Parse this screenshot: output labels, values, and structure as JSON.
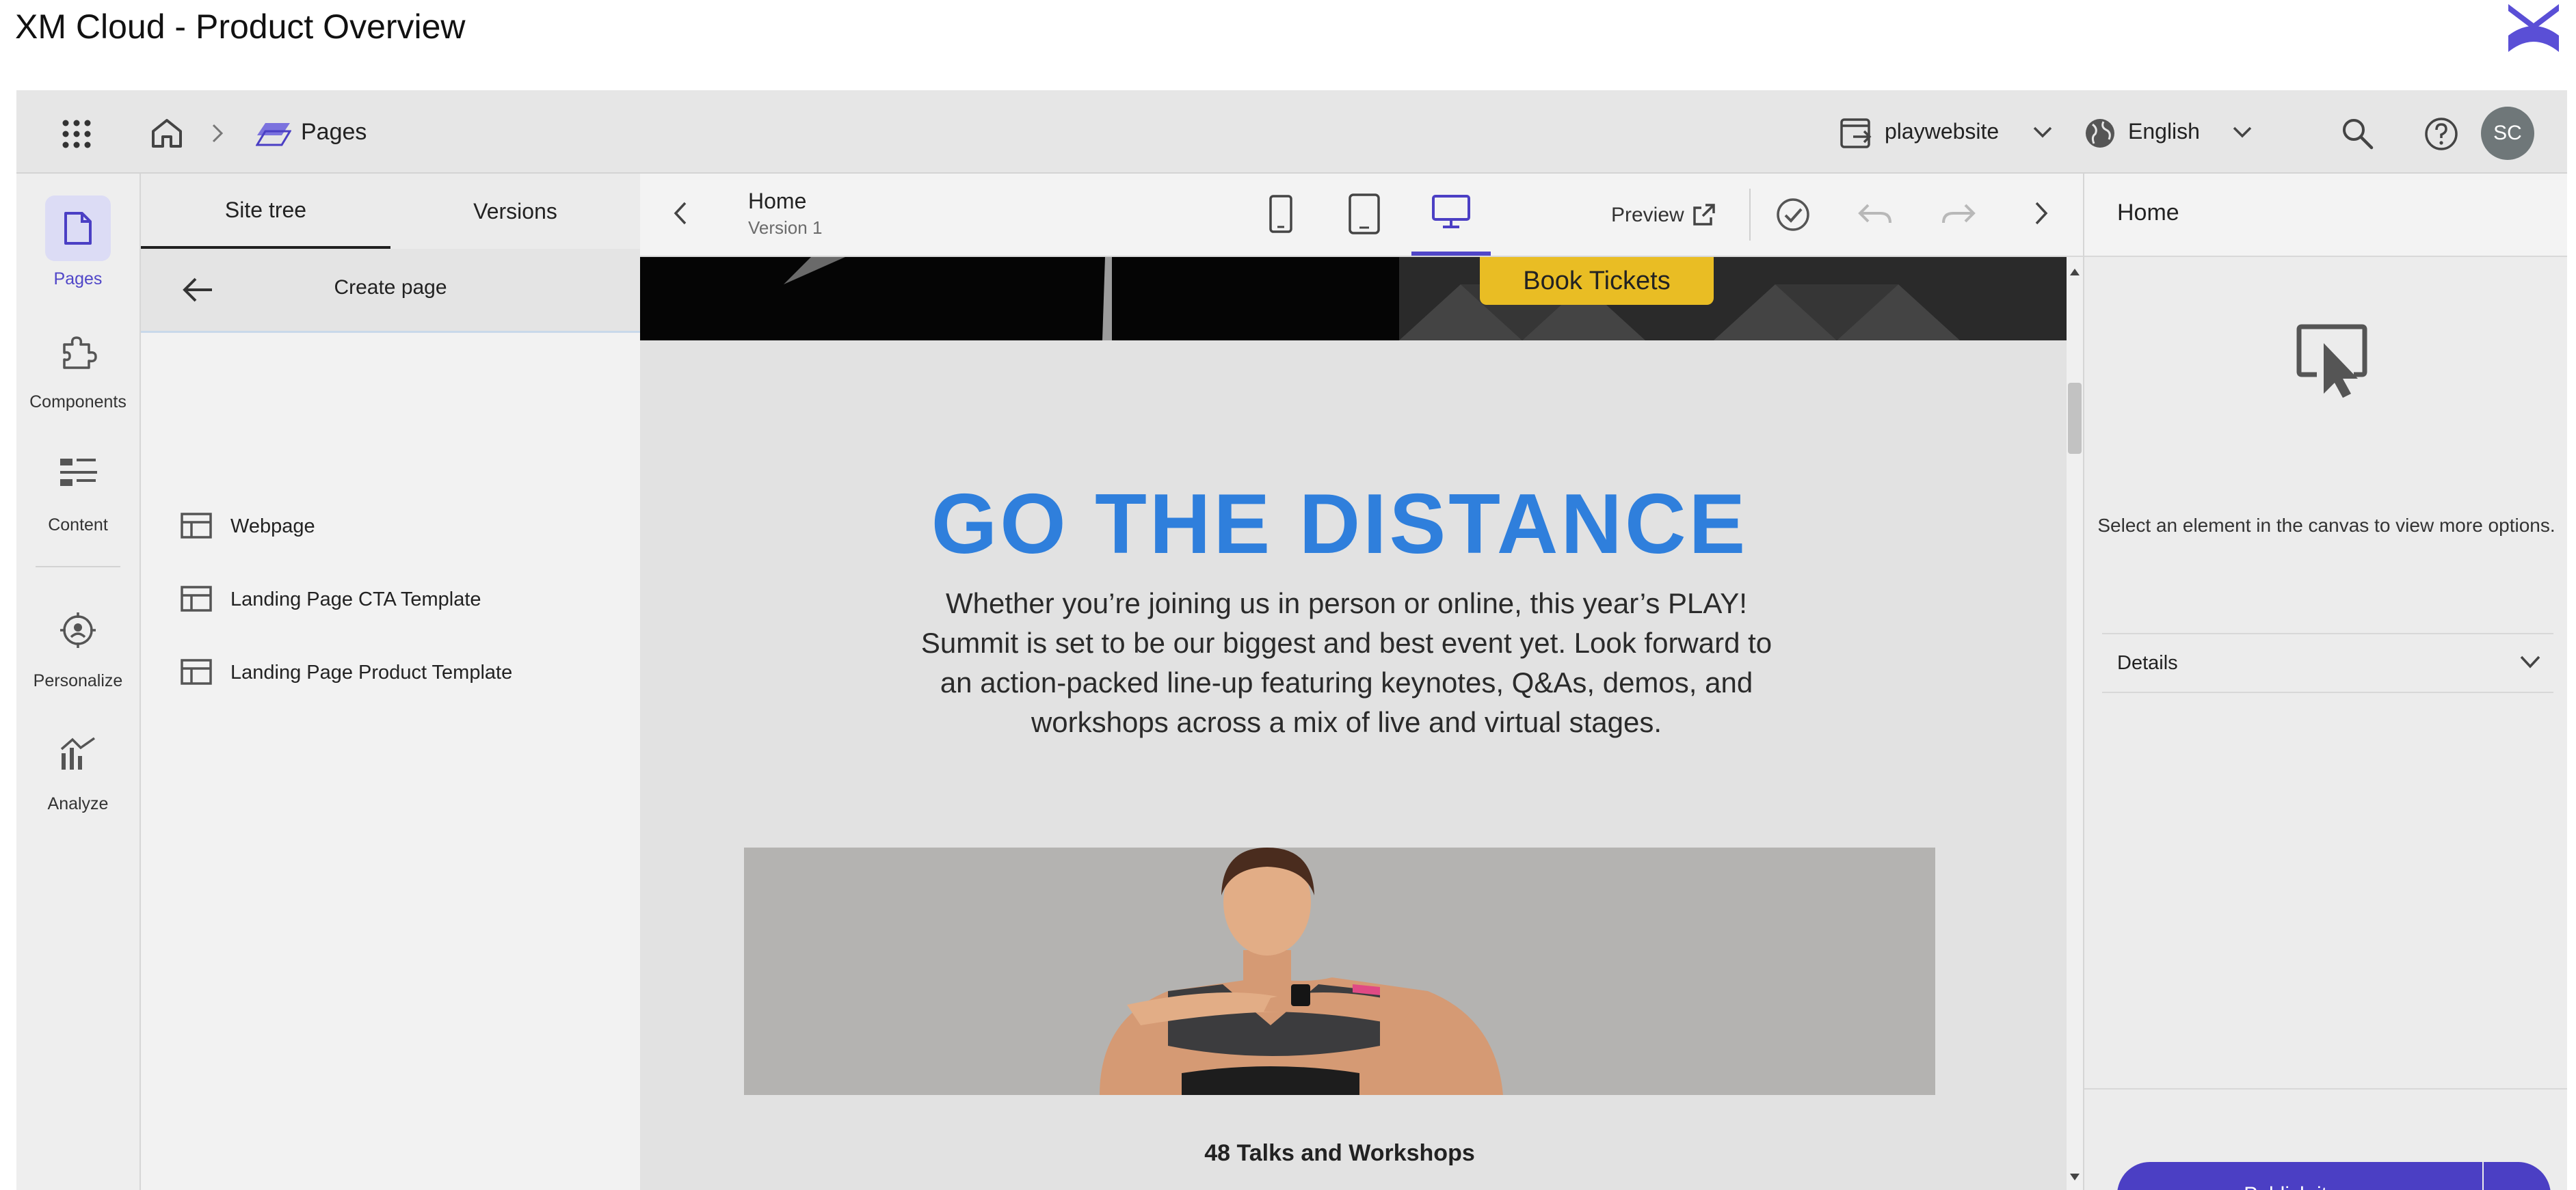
{
  "window": {
    "title": "XM Cloud - Product Overview"
  },
  "topbar": {
    "breadcrumb": "Pages",
    "site": "playwebsite",
    "language": "English",
    "avatar_initials": "SC"
  },
  "rail": {
    "items": [
      {
        "label": "Pages",
        "icon": "page-icon",
        "active": true
      },
      {
        "label": "Components",
        "icon": "puzzle-icon"
      },
      {
        "label": "Content",
        "icon": "content-list-icon"
      },
      {
        "label": "Personalize",
        "icon": "target-user-icon"
      },
      {
        "label": "Analyze",
        "icon": "analytics-icon"
      }
    ]
  },
  "left_panel": {
    "tabs": [
      "Site tree",
      "Versions"
    ],
    "create_page": "Create page",
    "templates": [
      "Webpage",
      "Landing Page CTA Template",
      "Landing Page Product Template"
    ]
  },
  "canvas_header": {
    "page_name": "Home",
    "version": "Version 1",
    "preview": "Preview"
  },
  "canvas": {
    "book_button": "Book Tickets",
    "headline": "GO THE DISTANCE",
    "body": "Whether you’re joining us in person or online, this year’s PLAY! Summit is set to be our biggest and best event yet. Look forward to an action-packed line-up featuring keynotes, Q&As, demos, and workshops across a mix of live and virtual stages.",
    "talks": "48 Talks and Workshops"
  },
  "right_panel": {
    "title": "Home",
    "empty_state": "Select an element in the canvas to view more options.",
    "details": "Details",
    "publish": "Publish item"
  },
  "colors": {
    "accent": "#4b3fc4",
    "headline": "#2f7fdc",
    "ticket_button": "#e9bd24"
  }
}
